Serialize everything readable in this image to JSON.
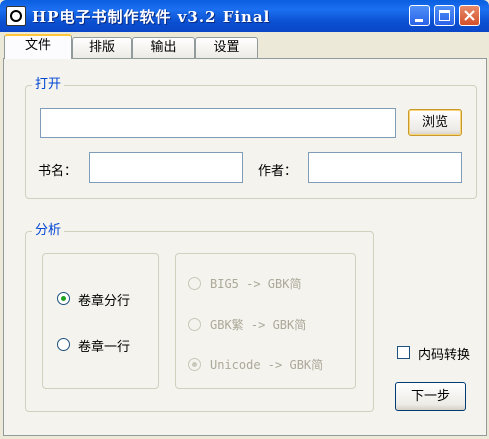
{
  "window": {
    "title": "HP电子书制作软件 v3.2 Final"
  },
  "tabs": [
    {
      "label": "文件",
      "active": true
    },
    {
      "label": "排版",
      "active": false
    },
    {
      "label": "输出",
      "active": false
    },
    {
      "label": "设置",
      "active": false
    }
  ],
  "open_group": {
    "legend": "打开",
    "file_path_value": "",
    "browse_label": "浏览",
    "book_name_label": "书名：",
    "book_name_value": "",
    "author_label": "作者：",
    "author_value": ""
  },
  "analysis_group": {
    "legend": "分析",
    "chapter_options": [
      {
        "label": "卷章分行",
        "selected": true
      },
      {
        "label": "卷章一行",
        "selected": false
      }
    ],
    "encoding_options": [
      {
        "label": "BIG5 -> GBK简",
        "selected": false,
        "enabled": false
      },
      {
        "label": "GBK繁 -> GBK简",
        "selected": false,
        "enabled": false
      },
      {
        "label": "Unicode -> GBK简",
        "selected": true,
        "enabled": false
      }
    ]
  },
  "internal_code_convert": {
    "label": "内码转换",
    "checked": false
  },
  "next_button": {
    "label": "下一步"
  },
  "colors": {
    "titlebar": "#0a5fe0",
    "legend_text": "#0046d5",
    "background": "#ece9d8",
    "tab_highlight": "#ffc83c"
  }
}
